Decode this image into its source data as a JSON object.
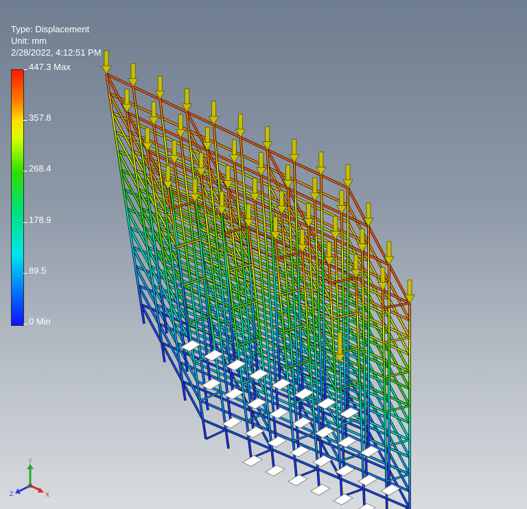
{
  "info": {
    "type_line": "Type: Displacement",
    "unit_line": "Unit: mm",
    "date_line": "2/28/2022, 4:12:51 PM"
  },
  "legend": {
    "labels": [
      "447.3 Max",
      "357.8",
      "268.4",
      "178.9",
      "89.5",
      "0 Min"
    ],
    "colors": {
      "max": "#ff1a00",
      "high": "#ffe100",
      "mid": "#2ee000",
      "low": "#00e8e8",
      "min": "#1010ff"
    }
  },
  "model": {
    "type": "scaffold-frame-structure",
    "load_arrow_color": "#c8c000",
    "support_color": "#ffffff"
  },
  "triad": {
    "y_label": "Y",
    "z_label": "Z",
    "x_label": "X"
  }
}
